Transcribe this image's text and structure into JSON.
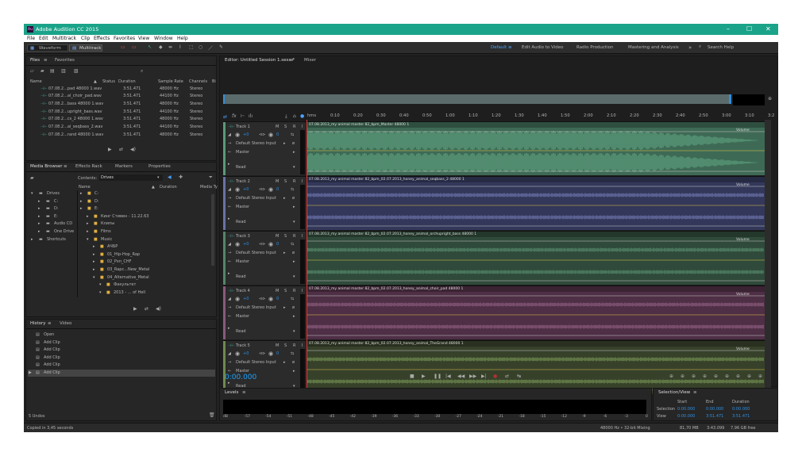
{
  "title": "Adobe Audition CC 2015",
  "logo": "Au",
  "window_controls": [
    "–",
    "☐",
    "✕"
  ],
  "menu": [
    "File",
    "Edit",
    "Multitrack",
    "Clip",
    "Effects",
    "Favorites",
    "View",
    "Window",
    "Help"
  ],
  "toolbar": {
    "waveform": "Waveform",
    "multitrack": "Multitrack",
    "workspaces": [
      "Default",
      "Edit Audio to Video",
      "Radio Production",
      "Mastering and Analysis"
    ],
    "more": "»",
    "search": "Search Help"
  },
  "files": {
    "tab_active": "Files",
    "tab_other": "Favorites",
    "cols": [
      "Name",
      "Status",
      "Duration",
      "Sample Rate",
      "Channels",
      "Bi"
    ],
    "rows": [
      [
        "07.08.2...pad 48000 1.wav",
        "3:51.471",
        "48000 Hz",
        "Stereo"
      ],
      [
        "07.08.2...al_choir_pad.wav",
        "3:51.471",
        "44100 Hz",
        "Stereo"
      ],
      [
        "07.08.2...bass 48000 1.wav",
        "3:51.471",
        "48000 Hz",
        "Stereo"
      ],
      [
        "07.08.2...upright_bass.wav",
        "3:51.471",
        "44100 Hz",
        "Stereo"
      ],
      [
        "07.08.2...cs_2 48000 1.wav",
        "3:51.471",
        "48000 Hz",
        "Stereo"
      ],
      [
        "07.08.2...al_seqbass_2.wav",
        "3:51.471",
        "44100 Hz",
        "Stereo"
      ],
      [
        "07.08.2...rand 48000 1.wav",
        "3:51.471",
        "48000 Hz",
        "Stereo"
      ]
    ]
  },
  "media": {
    "tabs": [
      "Media Browser",
      "Effects Rack",
      "Markers",
      "Properties"
    ],
    "contents_label": "Contents:",
    "contents_value": "Drives",
    "col_name": "Name",
    "col_duration": "Duration",
    "col_media": "Media Ty",
    "left": [
      "Drives",
      "C:",
      "D:",
      "E:",
      "Audio CD",
      "One Drive",
      "Shortcuts"
    ],
    "right": [
      "C:",
      "D:",
      "E:",
      "Кинг Стивен - 11.22.63",
      "Клипы",
      "Films",
      "Music",
      "АЧБР",
      "01_Hip-Hop_Rap",
      "02_Рэп_CHF",
      "03_Rapc...New_Metal",
      "04_Alternative_Metal",
      "Факультет",
      "2013 - ... of Hell"
    ]
  },
  "history": {
    "tabs": [
      "History",
      "Video"
    ],
    "items": [
      "Open",
      "Add Clip",
      "Add Clip",
      "Add Clip",
      "Add Clip",
      "Add Clip"
    ],
    "undos": "5 Undos"
  },
  "editor": {
    "tab": "Editor: Untitled Session 1.sesx *",
    "mixer": "Mixer",
    "ruler": [
      "hms",
      "0:10",
      "0:20",
      "0:30",
      "0:40",
      "0:50",
      "1:00",
      "1:10",
      "1:20",
      "1:30",
      "1:40",
      "1:50",
      "2:00",
      "2:10",
      "2:20",
      "2:30",
      "2:40",
      "2:50",
      "3:00",
      "3:10",
      "3:2"
    ]
  },
  "tracks": [
    {
      "name": "Track 1",
      "clip": "07.08.2013_my animal master 82_bpm_Master 48000 1",
      "color": "#3e6a55",
      "wave": "#5a9a7a"
    },
    {
      "name": "Track 2",
      "clip": "07.08.2013_my animal master 82_bpm_02.07.2013_honey_animal_seqbass_2 48000 1",
      "color": "#33385a",
      "wave": "#6a72a8"
    },
    {
      "name": "Track 3",
      "clip": "07.08.2013_my animal master 82_bpm_02.07.2013_honey_animal_orchupright_bass 48000 1",
      "color": "#2f4a3a",
      "wave": "#54866a"
    },
    {
      "name": "Track 4",
      "clip": "07.08.2013_my animal master 82_bpm_02.07.2013_honey_animal_choir_pad 48000 1",
      "color": "#4e2f45",
      "wave": "#8a5a7c"
    },
    {
      "name": "Track 5",
      "clip": "07.08.2013_my animal master 82_bpm_02.07.2013_honey_animal_TheGrand 48000 1",
      "color": "#37412a",
      "wave": "#6f8a4f"
    }
  ],
  "track_ctrl": {
    "vol": "+0",
    "pan": "0",
    "input": "Default Stereo Input",
    "output": "Master",
    "mode": "Read",
    "volume": "Volume",
    "btns": [
      "M",
      "S",
      "R",
      "I"
    ]
  },
  "time": "0:00.000",
  "levels": {
    "title": "Levels",
    "scale": [
      "dB",
      "-57",
      "-54",
      "-51",
      "-48",
      "-45",
      "-42",
      "-39",
      "-36",
      "-33",
      "-30",
      "-27",
      "-24",
      "-21",
      "-18",
      "-15",
      "-12",
      "-9",
      "-6",
      "-3",
      "0"
    ]
  },
  "selview": {
    "title": "Selection/View",
    "cols": [
      "Start",
      "End",
      "Duration"
    ],
    "rows": [
      [
        "Selection",
        "0:00.000",
        "0:00.000",
        "0:00.000"
      ],
      [
        "View",
        "0:00.000",
        "3:51.471",
        "3:51.471"
      ]
    ]
  },
  "status": {
    "left": "Copied in 3,45 seconds",
    "right": [
      "48000 Hz • 32-bit Mixing",
      "81,70 MB",
      "3:43.099",
      "7,96 GB free"
    ]
  },
  "colors": {
    "accent": "#1aa389",
    "blue": "#2f8fe0",
    "playhead": "#e23b3b"
  }
}
